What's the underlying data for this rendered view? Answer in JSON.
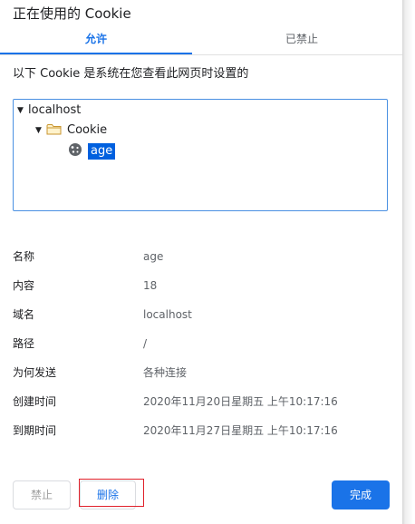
{
  "dialog": {
    "title": "正在使用的 Cookie"
  },
  "tabs": {
    "allowed_label": "允许",
    "blocked_label": "已禁止"
  },
  "description": "以下 Cookie 是系统在您查看此网页时设置的",
  "tree": {
    "host": "localhost",
    "folder": "Cookie",
    "cookie": "age"
  },
  "details": [
    {
      "key": "名称",
      "value": "age"
    },
    {
      "key": "内容",
      "value": "18"
    },
    {
      "key": "域名",
      "value": "localhost"
    },
    {
      "key": "路径",
      "value": "/"
    },
    {
      "key": "为何发送",
      "value": "各种连接"
    },
    {
      "key": "创建时间",
      "value": "2020年11月20日星期五 上午10:17:16"
    },
    {
      "key": "到期时间",
      "value": "2020年11月27日星期五 上午10:17:16"
    }
  ],
  "buttons": {
    "block_label": "禁止",
    "remove_label": "删除",
    "done_label": "完成"
  },
  "icons": {
    "expand": "triangle-down-icon",
    "folder": "folder-icon",
    "cookie": "cookie-icon"
  },
  "colors": {
    "accent": "#1a73e8",
    "selection": "#0060df",
    "highlight": "#e0202a"
  }
}
